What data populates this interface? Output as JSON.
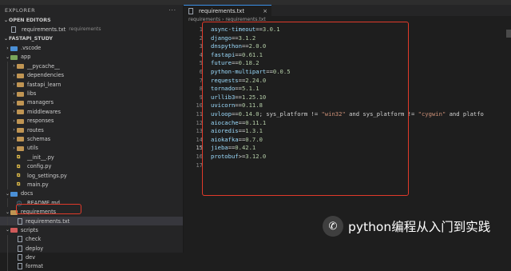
{
  "window": {
    "title_left": "requirements.txt",
    "title_right": "fastapi_study"
  },
  "sidebar": {
    "title": "EXPLORER",
    "more": "···",
    "open_editors": {
      "label": "OPEN EDITORS",
      "file": "requirements.txt",
      "folder": "requirements"
    },
    "project": "FASTAPI_STUDY",
    "tree": [
      {
        "label": "vscode",
        "prefix": ".",
        "kind": "folder-blue",
        "depth": 0,
        "chev": "›"
      },
      {
        "label": "app",
        "kind": "folder-green",
        "depth": 0,
        "chev": "⌄"
      },
      {
        "label": "__pycache__",
        "kind": "folder",
        "depth": 1,
        "chev": "›"
      },
      {
        "label": "dependencies",
        "kind": "folder",
        "depth": 1,
        "chev": "›"
      },
      {
        "label": "fastapi_learn",
        "kind": "folder",
        "depth": 1,
        "chev": "›"
      },
      {
        "label": "libs",
        "kind": "folder",
        "depth": 1,
        "chev": "›"
      },
      {
        "label": "managers",
        "kind": "folder",
        "depth": 1,
        "chev": "›"
      },
      {
        "label": "middlewares",
        "kind": "folder",
        "depth": 1,
        "chev": "›"
      },
      {
        "label": "responses",
        "kind": "folder",
        "depth": 1,
        "chev": "›"
      },
      {
        "label": "routes",
        "kind": "folder",
        "depth": 1,
        "chev": "›"
      },
      {
        "label": "schemas",
        "kind": "folder",
        "depth": 1,
        "chev": "›"
      },
      {
        "label": "utils",
        "kind": "folder",
        "depth": 1,
        "chev": "›"
      },
      {
        "label": "__init__.py",
        "kind": "py",
        "depth": 1,
        "chev": ""
      },
      {
        "label": "config.py",
        "kind": "py",
        "depth": 1,
        "chev": ""
      },
      {
        "label": "log_settings.py",
        "kind": "py",
        "depth": 1,
        "chev": ""
      },
      {
        "label": "main.py",
        "kind": "py",
        "depth": 1,
        "chev": ""
      },
      {
        "label": "docs",
        "kind": "folder-blue",
        "depth": 0,
        "chev": "⌄"
      },
      {
        "label": "README.md",
        "kind": "md",
        "depth": 1,
        "chev": ""
      },
      {
        "label": "requirements",
        "kind": "folder",
        "depth": 0,
        "chev": "⌄"
      },
      {
        "label": "requirements.txt",
        "kind": "txt",
        "depth": 1,
        "chev": "",
        "selected": true
      },
      {
        "label": "scripts",
        "kind": "folder-red",
        "depth": 0,
        "chev": "⌄"
      },
      {
        "label": "check",
        "kind": "txt",
        "depth": 1,
        "chev": ""
      },
      {
        "label": "deploy",
        "kind": "txt",
        "depth": 1,
        "chev": ""
      },
      {
        "label": "dev",
        "kind": "txt",
        "depth": 1,
        "chev": ""
      },
      {
        "label": "format",
        "kind": "txt",
        "depth": 1,
        "chev": ""
      }
    ]
  },
  "editor": {
    "tab_label": "requirements.txt",
    "tab_close": "×",
    "breadcrumb": "requirements › requirements.txt",
    "active_line": 15,
    "lines": [
      {
        "n": "1",
        "parts": [
          [
            "k",
            "async-timeout"
          ],
          [
            "op",
            "=="
          ],
          [
            "v",
            "3.0.1"
          ]
        ]
      },
      {
        "n": "2",
        "parts": [
          [
            "k",
            "django"
          ],
          [
            "op",
            "=="
          ],
          [
            "v",
            "3.1.2"
          ]
        ]
      },
      {
        "n": "3",
        "parts": [
          [
            "k",
            "dnspython"
          ],
          [
            "op",
            "=="
          ],
          [
            "v",
            "2.0.0"
          ]
        ]
      },
      {
        "n": "4",
        "parts": [
          [
            "k",
            "fastapi"
          ],
          [
            "op",
            "=="
          ],
          [
            "v",
            "0.61.1"
          ]
        ]
      },
      {
        "n": "5",
        "parts": [
          [
            "k",
            "future"
          ],
          [
            "op",
            "=="
          ],
          [
            "v",
            "0.18.2"
          ]
        ]
      },
      {
        "n": "6",
        "parts": [
          [
            "k",
            "python-multipart"
          ],
          [
            "op",
            "=="
          ],
          [
            "v",
            "0.0.5"
          ]
        ]
      },
      {
        "n": "7",
        "parts": [
          [
            "k",
            "requests"
          ],
          [
            "op",
            "=="
          ],
          [
            "v",
            "2.24.0"
          ]
        ]
      },
      {
        "n": "8",
        "parts": [
          [
            "k",
            "tornado"
          ],
          [
            "op",
            "=="
          ],
          [
            "v",
            "5.1.1"
          ]
        ]
      },
      {
        "n": "9",
        "parts": [
          [
            "k",
            "urllib3"
          ],
          [
            "op",
            "=="
          ],
          [
            "v",
            "1.25.10"
          ]
        ]
      },
      {
        "n": "10",
        "parts": [
          [
            "k",
            "uvicorn"
          ],
          [
            "op",
            "=="
          ],
          [
            "v",
            "0.11.8"
          ]
        ]
      },
      {
        "n": "11",
        "parts": [
          [
            "k",
            "uvloop"
          ],
          [
            "op",
            "=="
          ],
          [
            "v",
            "0.14.0"
          ],
          [
            "plain",
            "; sys_platform != "
          ],
          [
            "s",
            "\"win32\""
          ],
          [
            "plain",
            " and sys_platform != "
          ],
          [
            "s",
            "\"cygwin\""
          ],
          [
            "plain",
            " and platfo"
          ]
        ]
      },
      {
        "n": "12",
        "parts": [
          [
            "k",
            "aiocache"
          ],
          [
            "op",
            "=="
          ],
          [
            "v",
            "0.11.1"
          ]
        ]
      },
      {
        "n": "13",
        "parts": [
          [
            "k",
            "aioredis"
          ],
          [
            "op",
            "=="
          ],
          [
            "v",
            "1.3.1"
          ]
        ]
      },
      {
        "n": "14",
        "parts": [
          [
            "k",
            "aiokafka"
          ],
          [
            "op",
            "=="
          ],
          [
            "v",
            "0.7.0"
          ]
        ]
      },
      {
        "n": "15",
        "parts": [
          [
            "k",
            "jieba"
          ],
          [
            "op",
            "=="
          ],
          [
            "v",
            "0.42.1"
          ]
        ]
      },
      {
        "n": "16",
        "parts": [
          [
            "k",
            "protobuf"
          ],
          [
            "op",
            ">="
          ],
          [
            "v",
            "3.12.0"
          ]
        ]
      },
      {
        "n": "17",
        "parts": []
      }
    ]
  },
  "watermark": {
    "text": "python编程从入门到实践",
    "icon": "wechat-icon"
  },
  "colors": {
    "highlight_box": "#e03a2a",
    "accent": "#3a8ee6"
  }
}
